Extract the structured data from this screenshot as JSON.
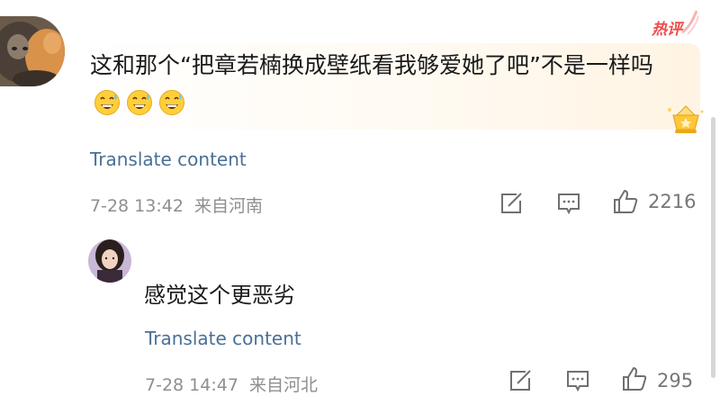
{
  "main_comment": {
    "badge": "热评",
    "text": "这和那个“把章若楠换成壁纸看我够爱她了吧”不是一样吗",
    "emoji_count": 3,
    "emoji_icon": "grinning-sweat-emoji",
    "translate_label": "Translate content",
    "timestamp": "7-28 13:42",
    "location": "来自河南",
    "like_count": "2216"
  },
  "reply": {
    "username": "",
    "text": "感觉这个更恶劣",
    "translate_label": "Translate content",
    "timestamp": "7-28 14:47",
    "location": "来自河北",
    "like_count": "295"
  },
  "colors": {
    "link": "#4a6f96",
    "meta": "#8f8f8f",
    "badge": "#ef4b4b"
  }
}
